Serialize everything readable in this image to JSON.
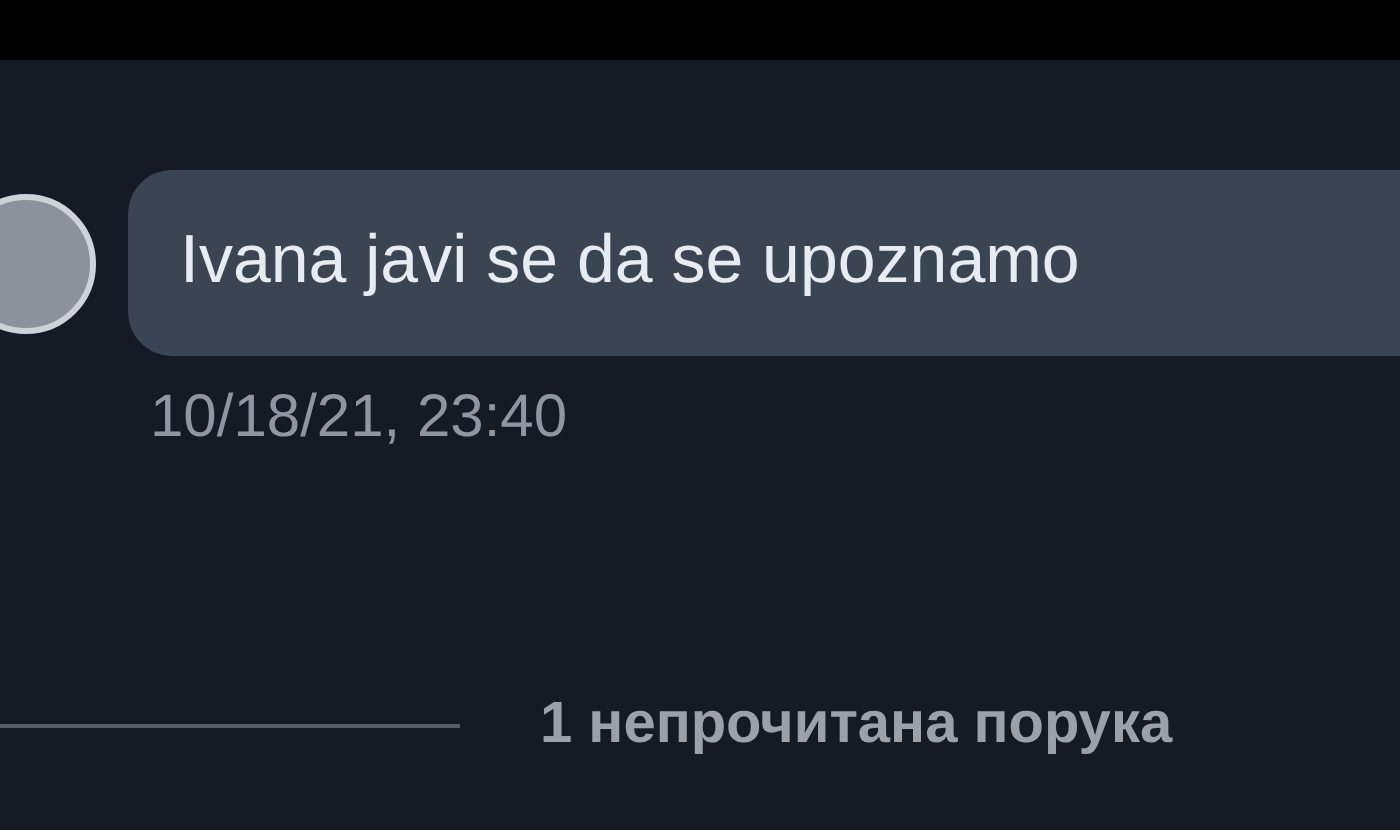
{
  "messages": [
    {
      "text": "Ivana javi se da se upoznamo",
      "timestamp": "10/18/21, 23:40"
    }
  ],
  "unread_divider": {
    "label": "1 непрочитана порука"
  }
}
